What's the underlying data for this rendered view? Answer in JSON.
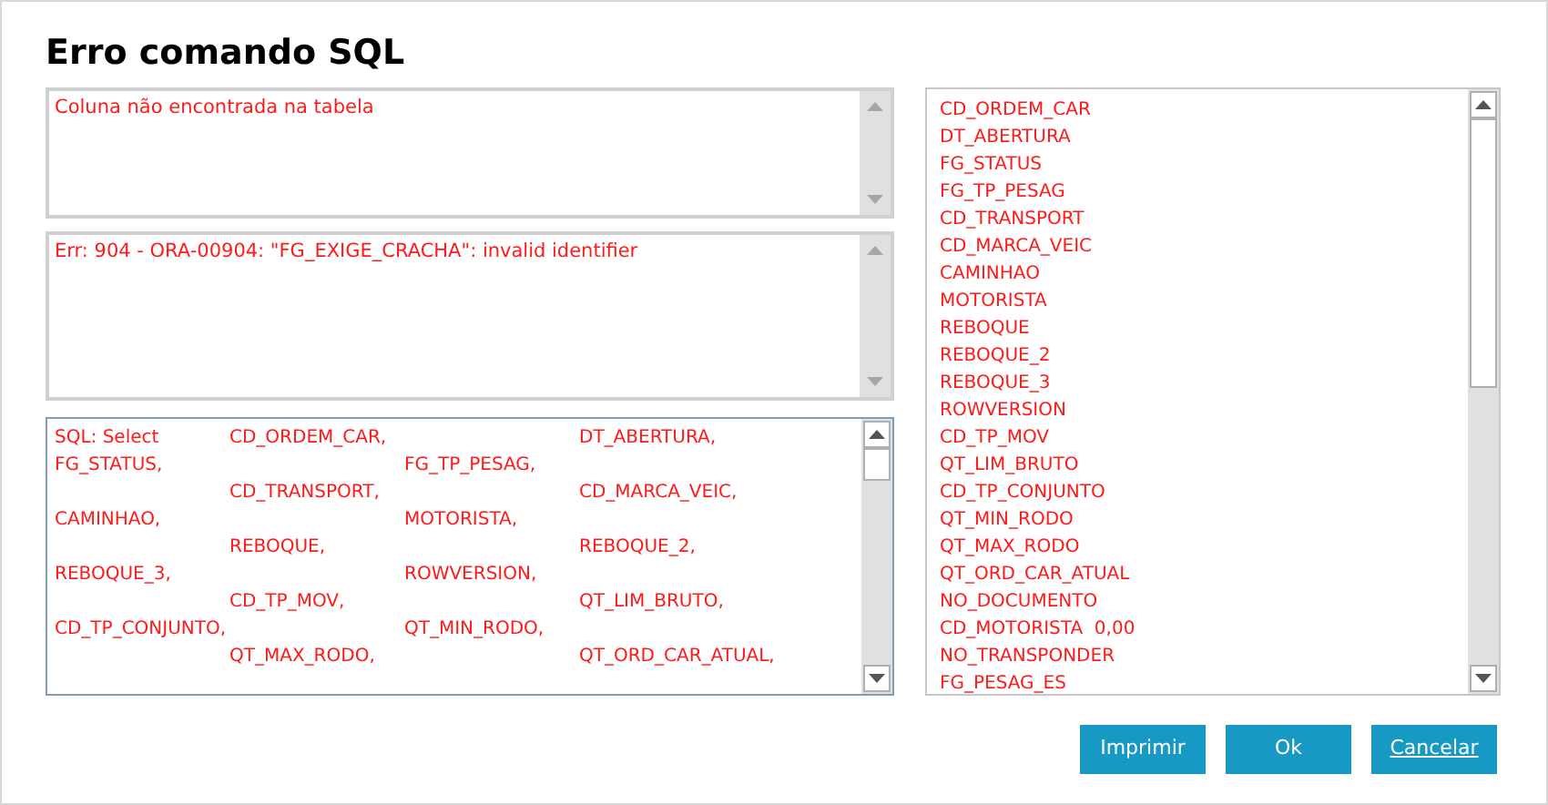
{
  "dialog": {
    "title": "Erro comando SQL"
  },
  "message": {
    "text": "Coluna não encontrada na tabela"
  },
  "error": {
    "text": "Err: 904 - ORA-00904: \"FG_EXIGE_CRACHA\": invalid identifier"
  },
  "sql_lines": [
    {
      "column_1": "SQL: Select",
      "column_2": "CD_ORDEM_CAR,",
      "column_4": "DT_ABERTURA,"
    },
    {
      "column_1": "FG_STATUS,",
      "column_3": "FG_TP_PESAG,"
    },
    {
      "column_2": "CD_TRANSPORT,",
      "column_4": "CD_MARCA_VEIC,"
    },
    {
      "column_1": "CAMINHAO,",
      "column_3": "MOTORISTA,"
    },
    {
      "column_2": "REBOQUE,",
      "column_4": "REBOQUE_2,"
    },
    {
      "column_1": "REBOQUE_3,",
      "column_3": "ROWVERSION,"
    },
    {
      "column_2": "CD_TP_MOV,",
      "column_4": "QT_LIM_BRUTO,"
    },
    {
      "column_1": "CD_TP_CONJUNTO,",
      "column_3": "QT_MIN_RODO,"
    },
    {
      "column_2": "QT_MAX_RODO,",
      "column_4": "QT_ORD_CAR_ATUAL,"
    }
  ],
  "columns_list": [
    "CD_ORDEM_CAR",
    "DT_ABERTURA",
    "FG_STATUS",
    "FG_TP_PESAG",
    "CD_TRANSPORT",
    "CD_MARCA_VEIC",
    "CAMINHAO",
    "MOTORISTA",
    "REBOQUE",
    "REBOQUE_2",
    "REBOQUE_3",
    "ROWVERSION",
    "CD_TP_MOV",
    "QT_LIM_BRUTO",
    "CD_TP_CONJUNTO",
    "QT_MIN_RODO",
    "QT_MAX_RODO",
    "QT_ORD_CAR_ATUAL",
    "NO_DOCUMENTO",
    "CD_MOTORISTA  0,00",
    "NO_TRANSPONDER",
    "FG_PESAG_ES"
  ],
  "buttons": [
    "Imprimir",
    "Ok",
    "Cancelar"
  ]
}
